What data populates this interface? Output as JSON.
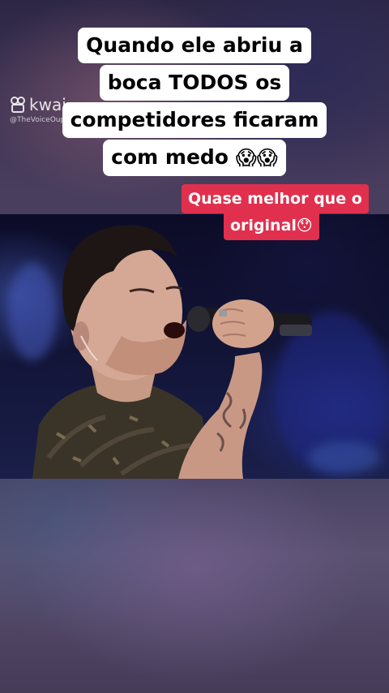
{
  "watermark": {
    "brand": "kwai",
    "handle": "@TheVoiceOupe"
  },
  "caption": {
    "lines": [
      "Quando ele abriu a",
      "boca TODOS os",
      "competidores ficaram",
      "com medo"
    ],
    "emojis": "😱😱"
  },
  "subcaption": {
    "line1": "Quase melhor que o",
    "line2": "original",
    "emoji": "😯"
  },
  "colors": {
    "caption_bg": "#ffffff",
    "subcaption_bg": "#e0304e",
    "subcaption_text": "#ffffff"
  }
}
